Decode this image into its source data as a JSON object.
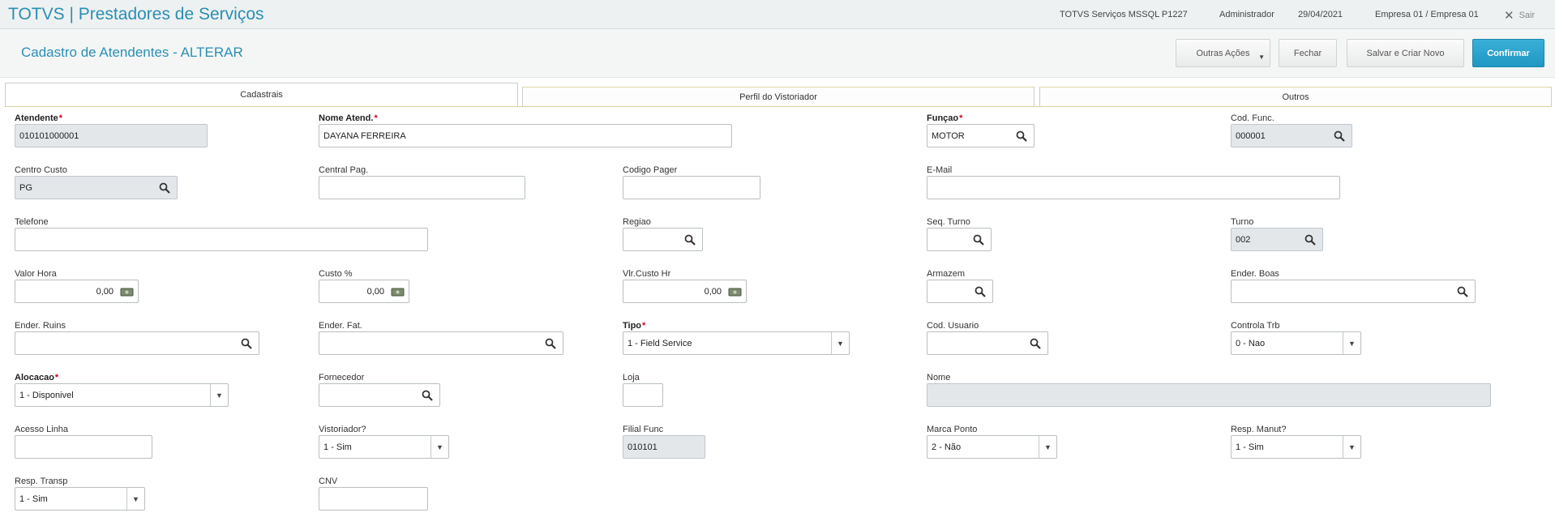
{
  "topbar": {
    "title": "TOTVS | Prestadores de Serviços",
    "environment": "TOTVS Serviços MSSQL P1227",
    "user": "Administrador",
    "date": "29/04/2021",
    "company": "Empresa 01 / Empresa 01",
    "logout_label": "Sair"
  },
  "header": {
    "page_title": "Cadastro de Atendentes - ALTERAR",
    "btn_more": "Outras Ações",
    "btn_close": "Fechar",
    "btn_save_new": "Salvar e Criar Novo",
    "btn_confirm": "Confirmar"
  },
  "tabs": [
    {
      "label": "Cadastrais",
      "active": true
    },
    {
      "label": "Perfil do Vistoriador",
      "active": false
    },
    {
      "label": "Outros",
      "active": false
    }
  ],
  "form": {
    "atendente": {
      "label": "Atendente",
      "value": "010101000001"
    },
    "nome_atend": {
      "label": "Nome Atend.",
      "value": "DAYANA FERREIRA"
    },
    "funcao": {
      "label": "Funçao",
      "value": "MOTOR"
    },
    "cod_func": {
      "label": "Cod. Func.",
      "value": "000001"
    },
    "centro_custo": {
      "label": "Centro Custo",
      "value": "PG"
    },
    "central_pag": {
      "label": "Central Pag.",
      "value": ""
    },
    "codigo_pager": {
      "label": "Codigo Pager",
      "value": ""
    },
    "email": {
      "label": "E-Mail",
      "value": ""
    },
    "telefone": {
      "label": "Telefone",
      "value": ""
    },
    "regiao": {
      "label": "Regiao",
      "value": ""
    },
    "seq_turno": {
      "label": "Seq. Turno",
      "value": ""
    },
    "turno": {
      "label": "Turno",
      "value": "002"
    },
    "valor_hora": {
      "label": "Valor Hora",
      "value": "0,00"
    },
    "custo_pct": {
      "label": "Custo  %",
      "value": "0,00"
    },
    "vlr_custo_hr": {
      "label": "Vlr.Custo Hr",
      "value": "0,00"
    },
    "armazem": {
      "label": "Armazem",
      "value": ""
    },
    "ender_boas": {
      "label": "Ender. Boas",
      "value": ""
    },
    "ender_ruins": {
      "label": "Ender. Ruins",
      "value": ""
    },
    "ender_fat": {
      "label": "Ender.  Fat.",
      "value": ""
    },
    "tipo": {
      "label": "Tipo",
      "value": "1 - Field Service"
    },
    "cod_usuario": {
      "label": "Cod. Usuario",
      "value": ""
    },
    "controla_trb": {
      "label": "Controla Trb",
      "value": "0 - Nao"
    },
    "alocacao": {
      "label": "Alocacao",
      "value": "1 - Disponivel"
    },
    "fornecedor": {
      "label": "Fornecedor",
      "value": ""
    },
    "loja": {
      "label": "Loja",
      "value": ""
    },
    "nome": {
      "label": "Nome",
      "value": ""
    },
    "acesso_linha": {
      "label": "Acesso Linha",
      "value": ""
    },
    "vistoriador": {
      "label": "Vistoriador?",
      "value": "1 - Sim"
    },
    "filial_func": {
      "label": "Filial Func",
      "value": "010101"
    },
    "marca_ponto": {
      "label": "Marca Ponto",
      "value": "2 - Não"
    },
    "resp_manut": {
      "label": "Resp. Manut?",
      "value": "1 - Sim"
    },
    "resp_transp": {
      "label": "Resp. Transp",
      "value": "1 - Sim"
    },
    "cnv": {
      "label": "CNV",
      "value": ""
    }
  },
  "icons": {
    "search": "search-icon",
    "money": "money-icon",
    "dropdown": "chevron-down-icon",
    "close": "close-icon"
  },
  "colors": {
    "brand": "#2a8fb3",
    "confirm": "#1f97c2",
    "required": "#d0021b",
    "readonly": "#e4e7ea"
  }
}
